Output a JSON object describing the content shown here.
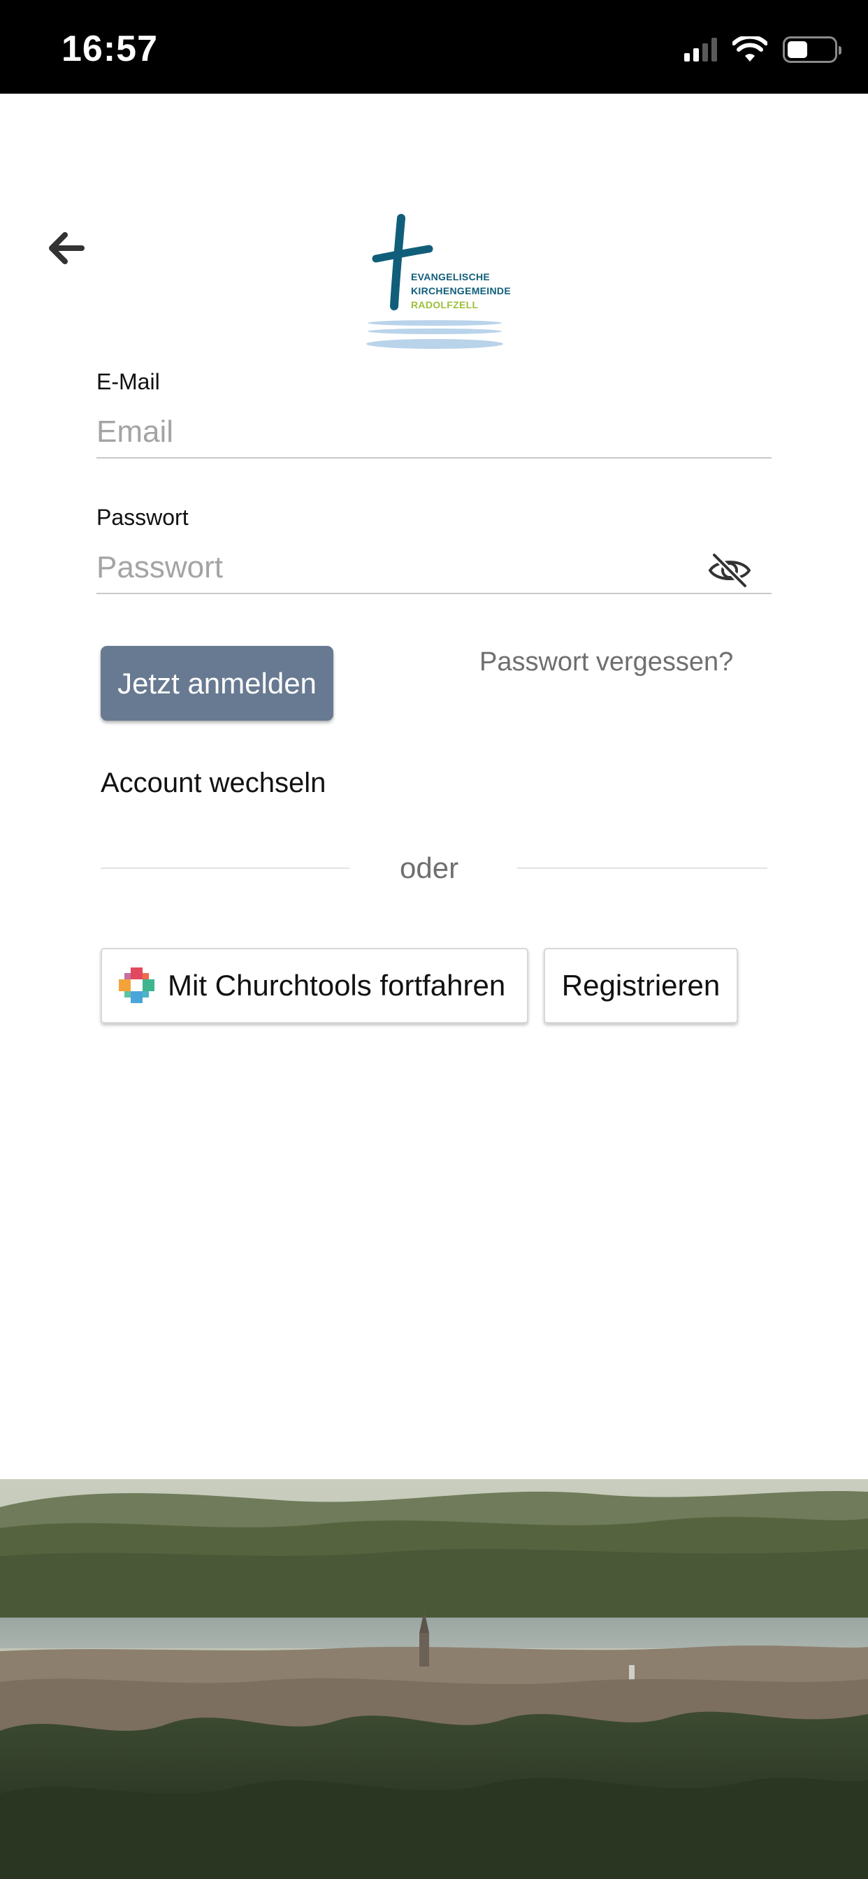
{
  "status_bar": {
    "time": "16:57"
  },
  "header": {
    "back_icon": "arrow-left-icon",
    "logo": {
      "line1": "EVANGELISCHE",
      "line2": "KIRCHENGEMEINDE",
      "line3": "RADOLFZELL"
    }
  },
  "form": {
    "email_label": "E-Mail",
    "email_placeholder": "Email",
    "email_value": "",
    "password_label": "Passwort",
    "password_placeholder": "Passwort",
    "password_value": "",
    "visibility_icon": "eye-off-icon"
  },
  "actions": {
    "login_label": "Jetzt anmelden",
    "forgot_label": "Passwort vergessen?",
    "switch_account_label": "Account wechseln",
    "or_label": "oder",
    "churchtools_label": "Mit Churchtools fortfahren",
    "churchtools_icon": "churchtools-logo-icon",
    "register_label": "Registrieren"
  },
  "colors": {
    "primary_button": "#687a91",
    "logo_blue": "#115e7a",
    "logo_green": "#9cbf3a",
    "muted_text": "#6f6f6f"
  }
}
